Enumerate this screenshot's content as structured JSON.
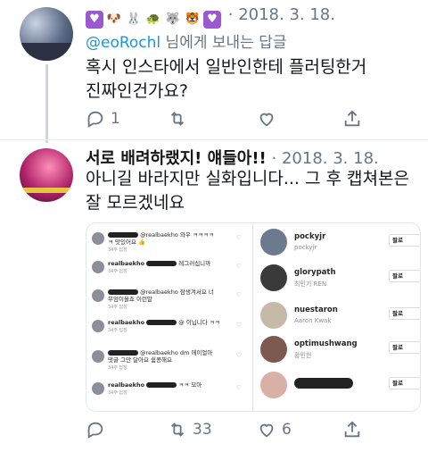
{
  "tweet1": {
    "emojis": [
      {
        "icon": "purple-heart-icon",
        "glyph": "♥",
        "bg": "#9b59d0",
        "fg": "#ffffff"
      },
      {
        "icon": "dog-face-icon",
        "glyph": "🐶",
        "bg": "transparent",
        "fg": "#b7793a"
      },
      {
        "icon": "rabbit-face-icon",
        "glyph": "🐰",
        "bg": "transparent",
        "fg": "#d8a0a6"
      },
      {
        "icon": "turtle-icon",
        "glyph": "🐢",
        "bg": "transparent",
        "fg": "#5c9b3a"
      },
      {
        "icon": "wolf-face-icon",
        "glyph": "🐺",
        "bg": "transparent",
        "fg": "#707a86"
      },
      {
        "icon": "tiger-face-icon",
        "glyph": "🐯",
        "bg": "transparent",
        "fg": "#e0a12c"
      },
      {
        "icon": "purple-heart-icon",
        "glyph": "♥",
        "bg": "#9b59d0",
        "fg": "#ffffff"
      }
    ],
    "separator": "·",
    "date": "2018. 3. 18.",
    "reply_handle": "@eoRochl",
    "reply_suffix": " 님에게 보내는 답글",
    "text_line1": "혹시 인스타에서 일반인한테 플러팅한거",
    "text_line2": "진짜인건가요?",
    "reply_count": "1",
    "retweet_count": "",
    "like_count": ""
  },
  "tweet2": {
    "name": "서로 배려하랬지! 얘들아!!",
    "separator": "·",
    "date": "2018. 3. 18.",
    "text_line1": "아니길 바라지만 실화입니다... 그 후 캡쳐본은",
    "text_line2": "잘 모르겠네요",
    "reply_count": "",
    "retweet_count": "33",
    "like_count": "6"
  },
  "media": {
    "comments": [
      {
        "user": "",
        "text": "@realbaekho 와우 ㅋㅋㅋㅋ",
        "line2": "ㅋ 맛있어요 👍",
        "meta": "34주  답장"
      },
      {
        "user": "realbaekho",
        "text": "레그러십니까",
        "line2": "",
        "meta": "34주  답장"
      },
      {
        "user": "",
        "text": "@realbaekho 잠생겨서요 너",
        "line2": "무엄이올죠 이런말",
        "meta": "34주  답장"
      },
      {
        "user": "realbaekho",
        "text": "@ 이닙니다 ㅋㅋ",
        "line2": "",
        "meta": "34주  답장"
      },
      {
        "user": "",
        "text": "@realbaekho dm 에이얼아",
        "line2": "댓글 그만 달아요 쉼콩해요",
        "meta": "34주  답장"
      },
      {
        "user": "realbaekho",
        "text": "ㅋㅋ 모아",
        "line2": "",
        "meta": "34주  답장"
      }
    ],
    "follows": [
      {
        "name": "pockyjr",
        "sub": "pockyjr",
        "color": "#6b7a8f"
      },
      {
        "name": "glorypath",
        "sub": "최민기 REN",
        "color": "#3a3a3a"
      },
      {
        "name": "nuestaron",
        "sub": "Aaron Kwak",
        "color": "#c6b9a8"
      },
      {
        "name": "optimushwang",
        "sub": "황민현",
        "color": "#7d5a4f"
      },
      {
        "name": "",
        "sub": "",
        "color": "#d9b0a5"
      }
    ],
    "follow_label": "팔로"
  }
}
